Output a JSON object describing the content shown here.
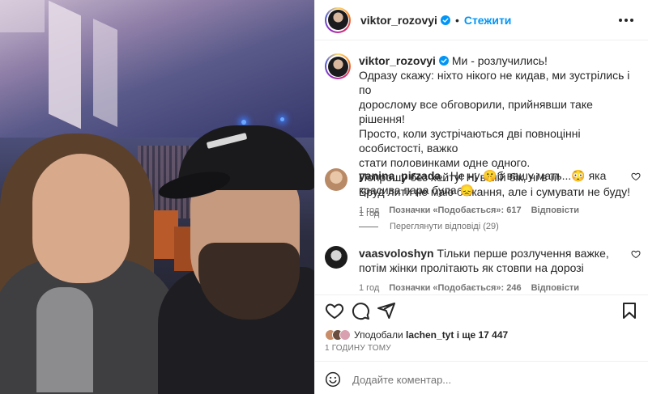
{
  "header": {
    "username": "viktor_rozovyi",
    "separator": "•",
    "follow_label": "Стежити"
  },
  "caption": {
    "username": "viktor_rozovyi",
    "lines": [
      "Ми - розлучились!",
      "Одразу скажу: ніхто нікого не кидав, ми зустрілись і по",
      "дорослому все обговорили, прийнявши таке рішення!",
      "Просто, коли зустрічаються дві повноцінні особистості, важко",
      "стати половинками одне одного.",
      "Попрошу без хейту! Ні в мій бік, ні в її!",
      "Бруд лити не маю бажання, але і сумувати не буду!"
    ],
    "time": "1 год"
  },
  "comments": [
    {
      "username": "yanina_pirzada_",
      "text": "Не ну 🤫б вашу мать...😳 яка красива пара була 😞",
      "time": "1 год",
      "likes": "Позначки «Подобається»: 617",
      "reply": "Відповісти",
      "view_replies": "Переглянути відповіді (29)"
    },
    {
      "username": "vaasvoloshyn",
      "text": "Тільки перше розлучення важке, потім жінки пролітають як стовпи на дорозі",
      "time": "1 год",
      "likes": "Позначки «Подобається»: 246",
      "reply": "Відповісти"
    }
  ],
  "likes_summary": {
    "prefix": "Уподобали",
    "user": "lachen_tyt",
    "suffix": "і ще 17 447"
  },
  "time_ago": "1 ГОДИНУ ТОМУ",
  "add_comment": {
    "placeholder": "Додайте коментар..."
  },
  "icons": [
    "verified-icon",
    "more-icon",
    "heart-icon",
    "comment-icon",
    "share-icon",
    "bookmark-icon",
    "emoji-icon"
  ],
  "colors": {
    "accent": "#0095f6",
    "text": "#262626",
    "secondary": "#737373",
    "border": "#efefef"
  }
}
